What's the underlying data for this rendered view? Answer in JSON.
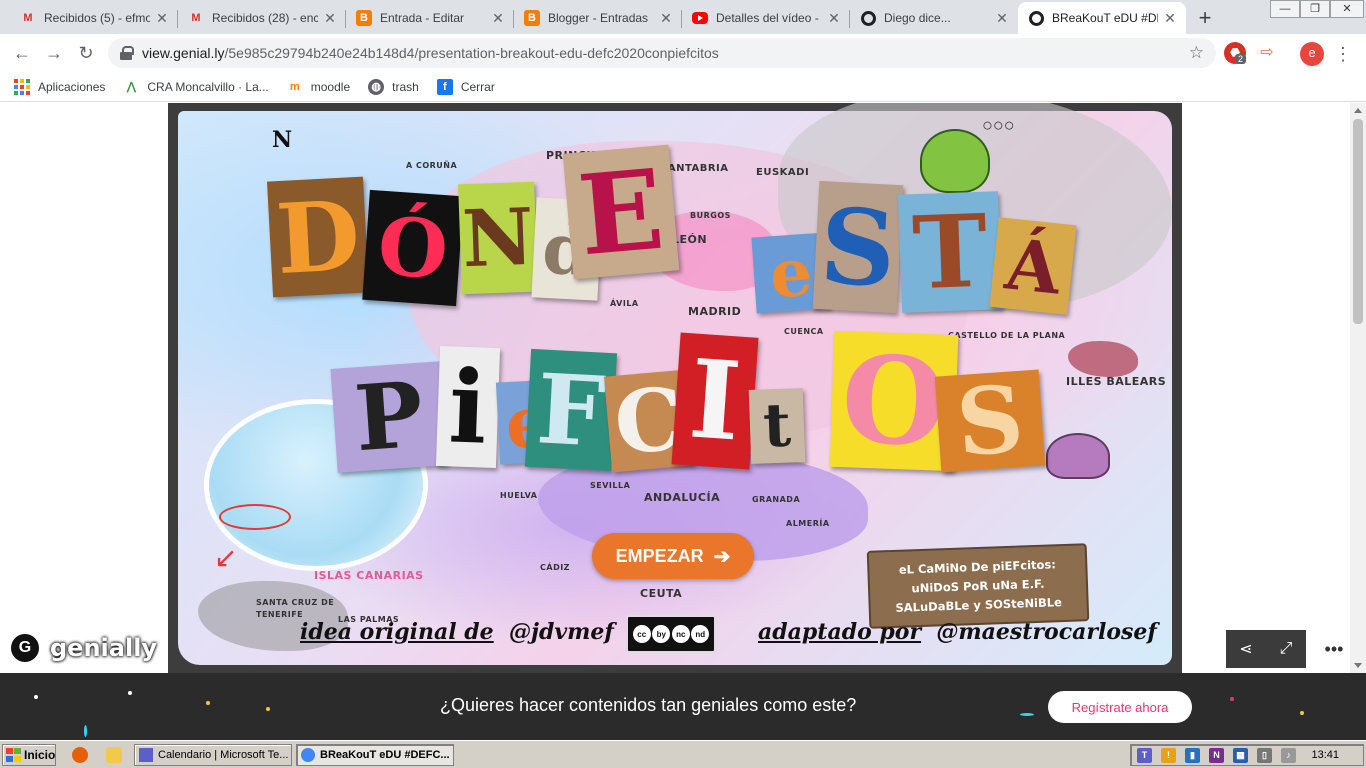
{
  "browser": {
    "tabs": [
      {
        "title": "Recibidos (5) - efmoncal",
        "icon": "gmail-icon",
        "active": false
      },
      {
        "title": "Recibidos (28) - encarna",
        "icon": "gmail-icon",
        "active": false
      },
      {
        "title": "Entrada - Editar",
        "icon": "blogger-icon",
        "active": false
      },
      {
        "title": "Blogger - Entradas",
        "icon": "blogger-icon",
        "active": false
      },
      {
        "title": "Detalles del vídeo - YouTube",
        "icon": "youtube-icon",
        "active": false
      },
      {
        "title": "Diego dice...",
        "icon": "genially-icon",
        "active": false
      },
      {
        "title": "BReaKouT eDU #DEFC2020",
        "icon": "genially-icon",
        "active": true
      }
    ],
    "new_tab_label": "+",
    "url_host": "view.genial.ly",
    "url_path": "/5e985c29794b240e24b148d4/presentation-breakout-edu-defc2020conpiefcitos",
    "extension_badge": "2",
    "profile_initial": "e",
    "bookmarks": [
      {
        "label": "Aplicaciones",
        "icon": "apps-grid-icon"
      },
      {
        "label": "CRA Moncalvillo · La...",
        "icon": "cra-icon"
      },
      {
        "label": "moodle",
        "icon": "moodle-icon"
      },
      {
        "label": "trash",
        "icon": "globe-icon"
      },
      {
        "label": "Cerrar",
        "icon": "facebook-icon"
      }
    ]
  },
  "slide": {
    "title_line1": [
      "D",
      "Ó",
      "N",
      "d",
      "E",
      "e",
      "S",
      "T",
      "Á"
    ],
    "title_line2": [
      "P",
      "i",
      "e",
      "F",
      "C",
      "I",
      "t",
      "O",
      "S"
    ],
    "map_labels": [
      "A CORUÑA",
      "PRINCIPADO",
      "CANTABRIA",
      "EUSKADI",
      "BURGOS",
      "LEÓN",
      "MADRID",
      "ÁVILA",
      "CUENCA",
      "CASTELLO DE LA PLANA",
      "ILLES BALEARS",
      "SEVILLA",
      "HUELVA",
      "ANDALUCÍA",
      "GRANADA",
      "ALMERÍA",
      "CÁDIZ",
      "CEUTA",
      "ISLAS CANARIAS",
      "SANTA CRUZ DE TENERIFE",
      "LAS PALMAS"
    ],
    "start_button": "EMPEZAR",
    "sign_lines": [
      "eL CaMiNo De piEFcitos:",
      "uNiDoS PoR uNa E.F.",
      "SALuDaBLe y SOSteNiBLe"
    ],
    "credit_left_underlined": "idea original de",
    "credit_left_handle": "@jdvmef",
    "credit_right_underlined": "adaptado por",
    "credit_right_handle": "@maestrocarlosef",
    "license_icons": [
      "cc",
      "by",
      "nc",
      "nd"
    ],
    "brand": "genially",
    "controls_more": "•••"
  },
  "promo": {
    "text": "¿Quieres hacer contenidos tan geniales como este?",
    "button": "Regístrate ahora"
  },
  "taskbar": {
    "start_label": "Inicio",
    "tasks": [
      {
        "label": "Calendario | Microsoft Te...",
        "active": false
      },
      {
        "label": "BReaKouT eDU #DEFC...",
        "active": true
      }
    ],
    "clock": "13:41"
  },
  "colors": {
    "accent_orange": "#e9762b",
    "promo_bg": "#2b2b2b",
    "promo_button_text": "#e53971"
  }
}
